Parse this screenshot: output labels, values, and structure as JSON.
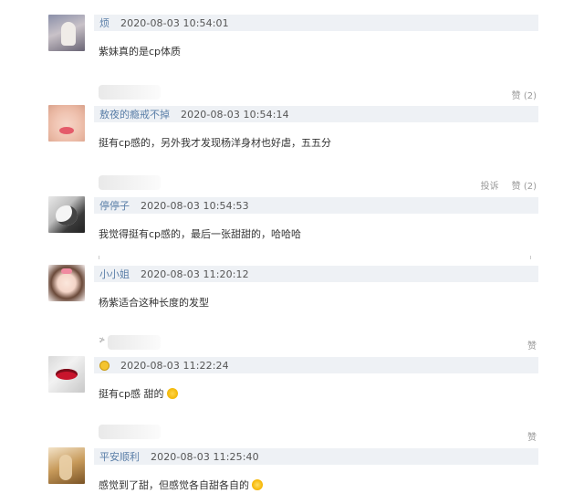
{
  "comments": [
    {
      "user": "烦",
      "time": "2020-08-03 10:54:01",
      "text": "紫妹真的是cp体质"
    },
    {
      "user": "敖夜的瘾戒不掉",
      "time": "2020-08-03 10:54:14",
      "text": "挺有cp感的，另外我才发现杨洋身材也好虐，五五分"
    },
    {
      "user": "停停子",
      "time": "2020-08-03 10:54:53",
      "text": "我觉得挺有cp感的，最后一张甜甜的，哈哈哈"
    },
    {
      "user": "小小姐",
      "time": "2020-08-03 11:20:12",
      "text": "杨紫适合这种长度的发型"
    },
    {
      "user": "",
      "time": "2020-08-03 11:22:24",
      "text": "挺有cp感 甜的"
    },
    {
      "user": "平安顺利",
      "time": "2020-08-03 11:25:40",
      "text": "感觉到了甜，但感觉各自甜各自的"
    }
  ],
  "actions": {
    "like_2": "赞 (2)",
    "report": "投诉",
    "like": "赞"
  },
  "partial_name_char": "≯"
}
